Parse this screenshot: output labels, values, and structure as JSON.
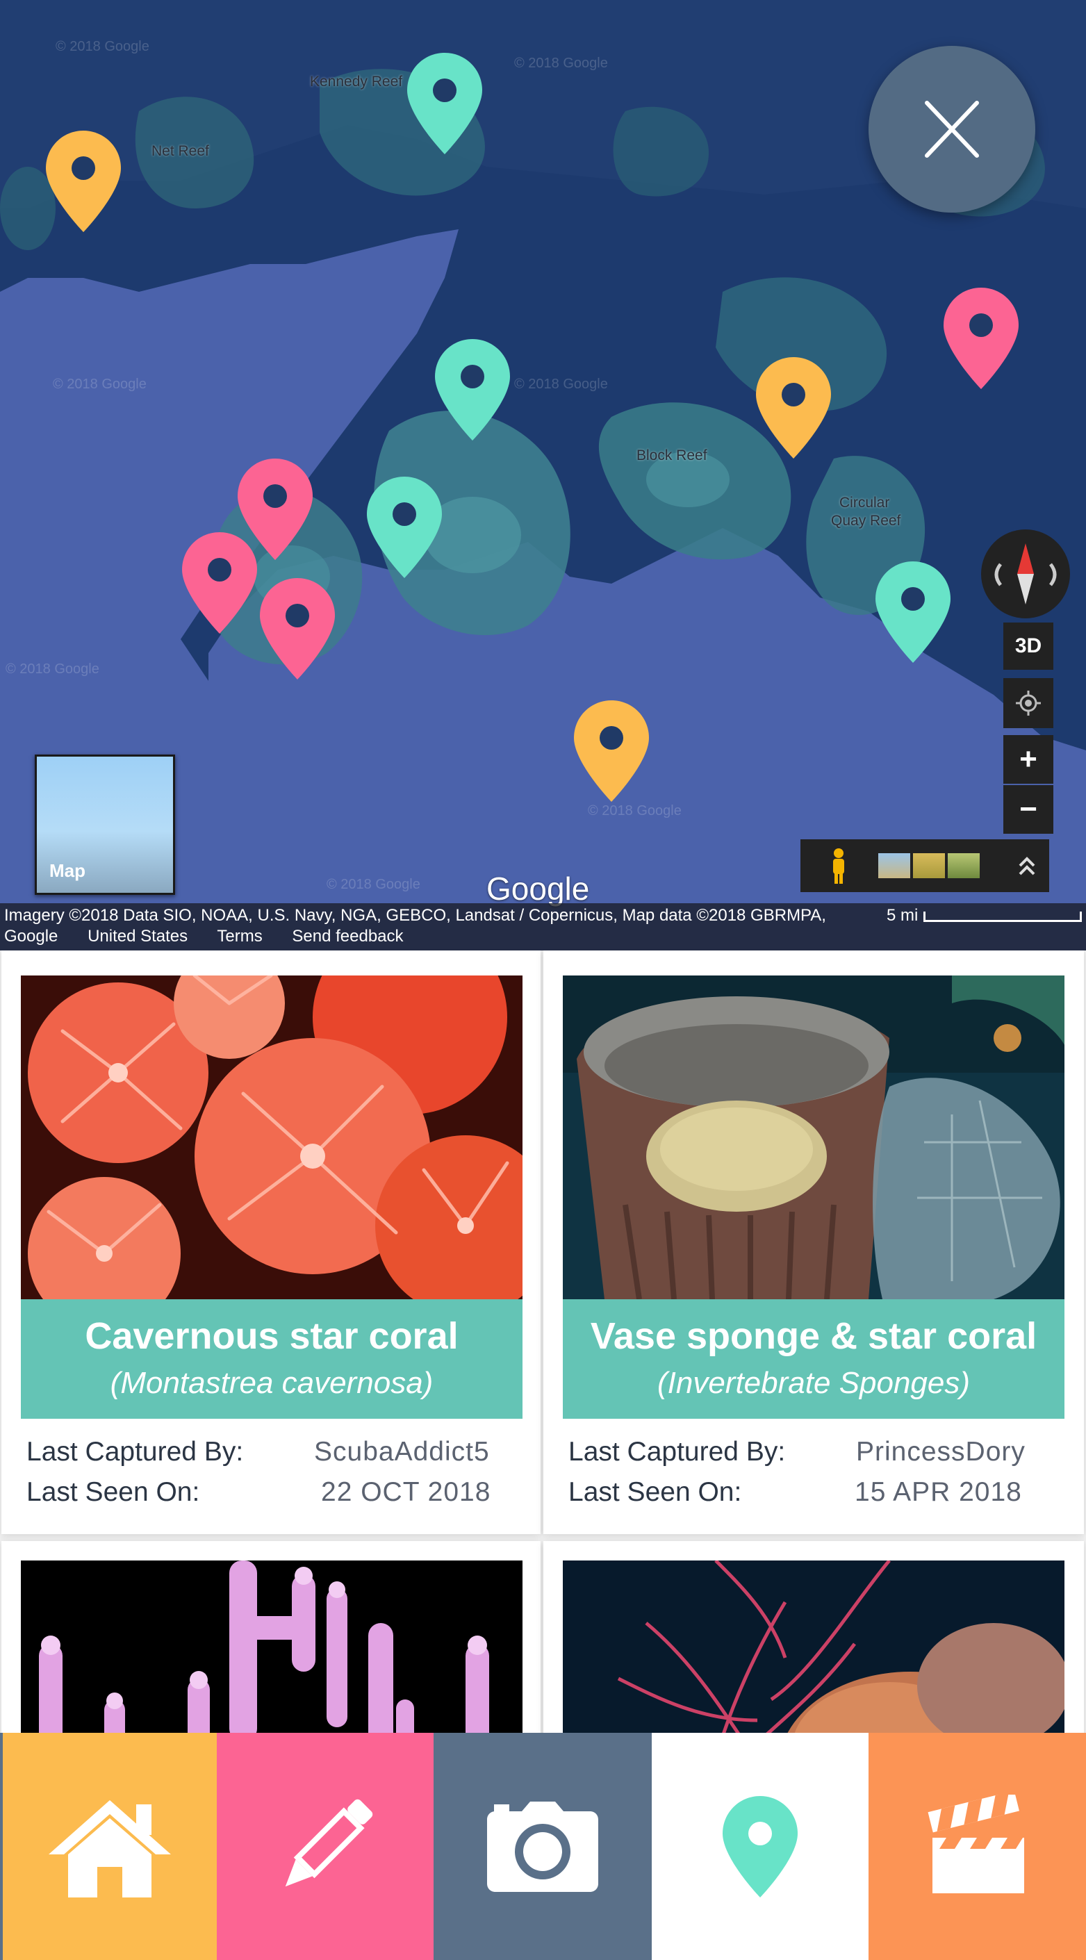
{
  "map": {
    "place_labels": {
      "kennedy_reef": "Kennedy Reef",
      "net_reef": "Net Reef",
      "block_reef": "Block Reef",
      "circular_quay_reef_1": "Circular",
      "circular_quay_reef_2": "Quay Reef"
    },
    "watermark": "© 2018 Google",
    "markers": [
      {
        "color": "#fcbb4f"
      },
      {
        "color": "#68e3c8"
      },
      {
        "color": "#fc6493"
      },
      {
        "color": "#68e3c8"
      },
      {
        "color": "#fcbb4f"
      },
      {
        "color": "#fc6493"
      },
      {
        "color": "#68e3c8"
      },
      {
        "color": "#fc6493"
      },
      {
        "color": "#fc6493"
      },
      {
        "color": "#68e3c8"
      },
      {
        "color": "#fcbb4f"
      }
    ],
    "close_button_label": "X",
    "controls": {
      "three_d": "3D",
      "zoom_in": "+",
      "zoom_out": "−",
      "map_type": "Map"
    },
    "google_logo": "Google",
    "attribution_line1": "Imagery ©2018 Data SIO, NOAA, U.S. Navy, NGA, GEBCO, Landsat / Copernicus, Map data ©2018 GBRMPA,",
    "attribution_links": [
      "Google",
      "United States",
      "Terms",
      "Send feedback"
    ],
    "scale_label": "5 mi"
  },
  "cards": [
    {
      "title": "Cavernous star coral",
      "subtitle": "(Montastrea cavernosa)",
      "captured_by_label": "Last Captured By:",
      "captured_by": "ScubaAddict5",
      "seen_on_label": "Last Seen On:",
      "seen_on": "22 OCT 2018"
    },
    {
      "title": "Vase sponge & star coral",
      "subtitle": "(Invertebrate Sponges)",
      "captured_by_label": "Last Captured By:",
      "captured_by": "PrincessDory",
      "seen_on_label": "Last Seen On:",
      "seen_on": "15 APR 2018"
    }
  ],
  "nav": {
    "items": [
      {
        "icon": "home-icon",
        "color": "#fcbb4f"
      },
      {
        "icon": "pencil-icon",
        "color": "#fc6493"
      },
      {
        "icon": "camera-icon",
        "color": "#5a7089"
      },
      {
        "icon": "map-pin-icon",
        "color": "#ffffff",
        "active": true
      },
      {
        "icon": "clapperboard-icon",
        "color": "#fc9455"
      }
    ]
  },
  "colors": {
    "teal": "#64c4b5",
    "pin_teal": "#68e3c8",
    "pin_yellow": "#fcbb4f",
    "pin_pink": "#fc6493",
    "slate": "#5a7089",
    "orange": "#fc9455"
  }
}
